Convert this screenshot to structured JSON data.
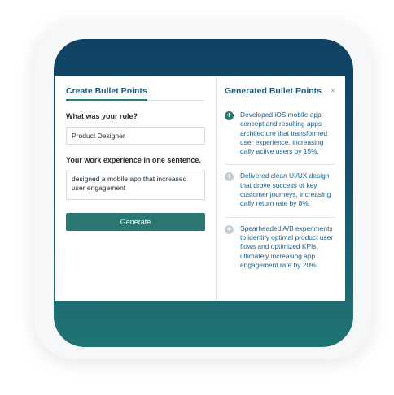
{
  "left": {
    "tab_title": "Create Bullet Points",
    "role_label": "What was your role?",
    "role_value": "Product Designer",
    "experience_label": "Your work experience in one sentence.",
    "experience_value": "designed a mobile app that increased user engagement",
    "generate_label": "Generate"
  },
  "right": {
    "title": "Generated Bullet Points",
    "close_icon": "×",
    "bullets": [
      {
        "text": "Developed iOS mobile app concept and resulting apps architecture that transformed user experience, increasing daily active users by 15%.",
        "icon": "plus-icon",
        "state": "active"
      },
      {
        "text": "Delivered clean UI/UX design that drove success of key customer journeys, increasing daily return rate by 8%.",
        "icon": "plus-icon",
        "state": "idle"
      },
      {
        "text": "Spearheaded A/B experiments to identify optimal product user flows and optimized KPIs, ultimately increasing app engagement rate by 20%.",
        "icon": "plus-icon",
        "state": "idle"
      }
    ]
  },
  "colors": {
    "accent": "#2b7772",
    "title_blue": "#1b5a80",
    "frame_top": "#0f4163",
    "frame_bottom": "#1e7473"
  }
}
